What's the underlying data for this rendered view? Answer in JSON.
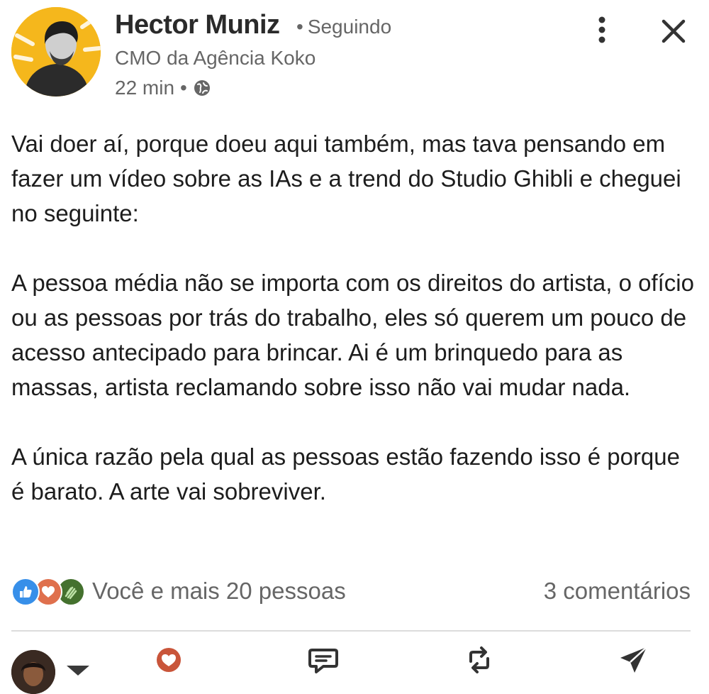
{
  "post": {
    "author": {
      "name": "Hector Muniz",
      "follow_status": "Seguindo",
      "headline": "CMO da Agência Koko",
      "time": "22 min"
    },
    "body": [
      "Vai doer aí, porque doeu aqui também, mas tava pensando em fazer um vídeo sobre as IAs e a trend do Studio Ghibli e cheguei no seguinte:",
      "A pessoa média não se importa com os direitos do artista, o ofício ou as pessoas por trás do trabalho, eles só querem um pouco de acesso antecipado para brincar. Ai é um brinquedo para as massas, artista reclamando sobre isso não vai mudar nada.",
      "A única razão pela qual as pessoas estão fazendo isso é porque é barato. A arte vai sobreviver."
    ],
    "reactions_label": "Você e mais 20 pessoas",
    "comments_count": "3 comentários"
  },
  "icons": {
    "more": "more-vertical-icon",
    "close": "close-icon",
    "visibility": "globe-icon",
    "reaction_like": "thumbs-up-icon",
    "reaction_love": "heart-icon",
    "reaction_celebrate": "clapping-hands-icon",
    "action_react": "heart-icon",
    "action_comment": "comment-icon",
    "action_repost": "repost-icon",
    "action_send": "send-icon"
  },
  "colors": {
    "like": "#378fe9",
    "love": "#df704d",
    "celebrate": "#44712e",
    "react_action": "#c9553a",
    "avatar_bg": "#f5b71c"
  }
}
